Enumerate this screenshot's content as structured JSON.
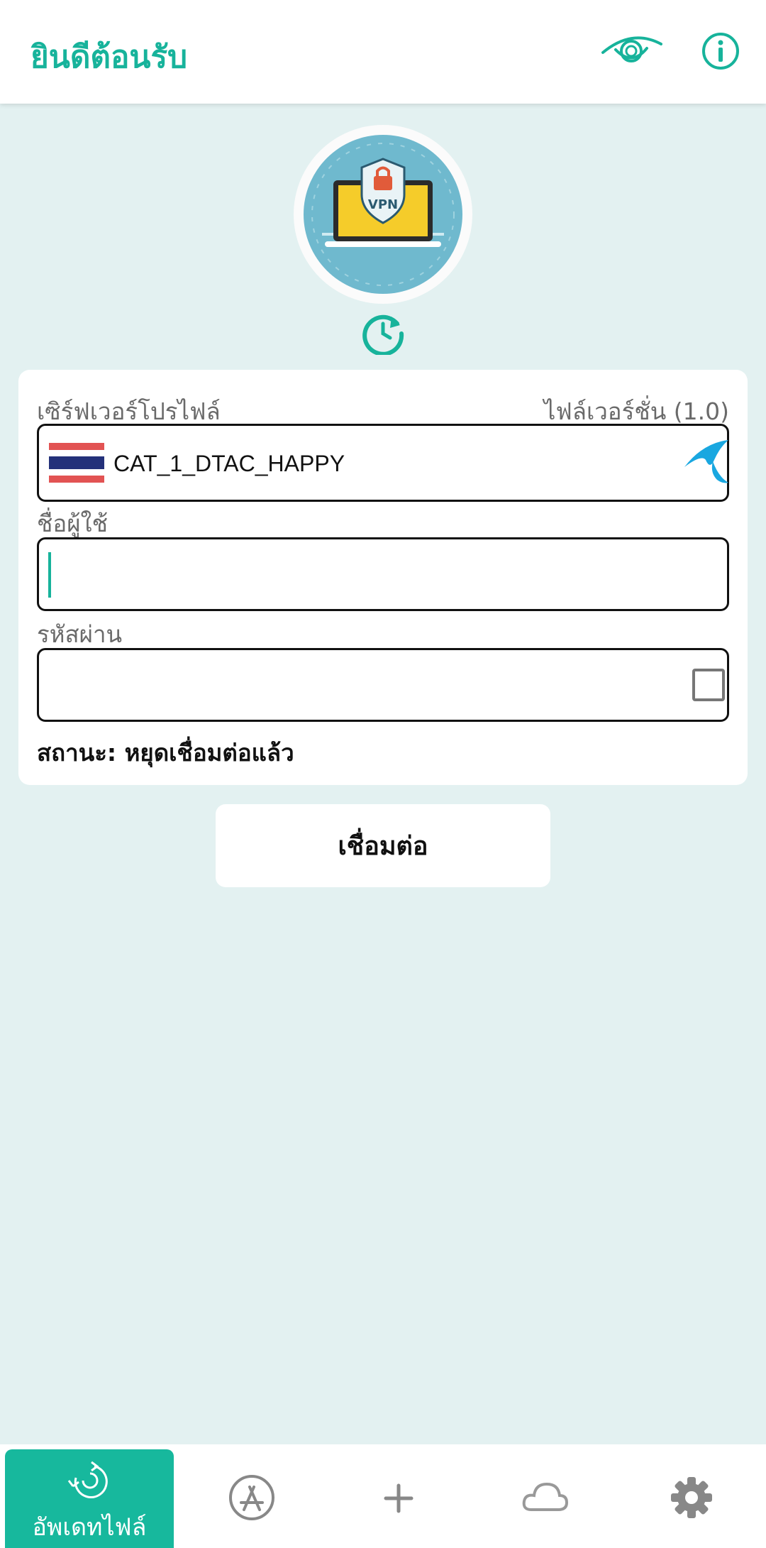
{
  "header": {
    "title": "ยินดีต้อนรับ",
    "icons": [
      "eye-icon",
      "info-icon"
    ]
  },
  "logo": {
    "text": "VPN"
  },
  "card": {
    "server_profile_label": "เซิร์ฟเวอร์โปรไฟล์",
    "file_version_label": "ไฟล์เวอร์ชั่น (1.0)",
    "server_name": "CAT_1_DTAC_HAPPY",
    "username_label": "ชื่อผู้ใช้",
    "username_value": "",
    "password_label": "รหัสผ่าน",
    "password_value": "",
    "status_text": "สถานะ: หยุดเชื่อมต่อแล้ว"
  },
  "connect_button": "เชื่อมต่อ",
  "bottom_nav": {
    "active_label": "อัพเดทไฟล์",
    "items": [
      "update-file-icon",
      "app-store-icon",
      "plus-icon",
      "cloud-icon",
      "gear-icon"
    ]
  },
  "colors": {
    "accent": "#17b39b",
    "background": "#e3f1f1",
    "carrier": "#19a7e0"
  }
}
